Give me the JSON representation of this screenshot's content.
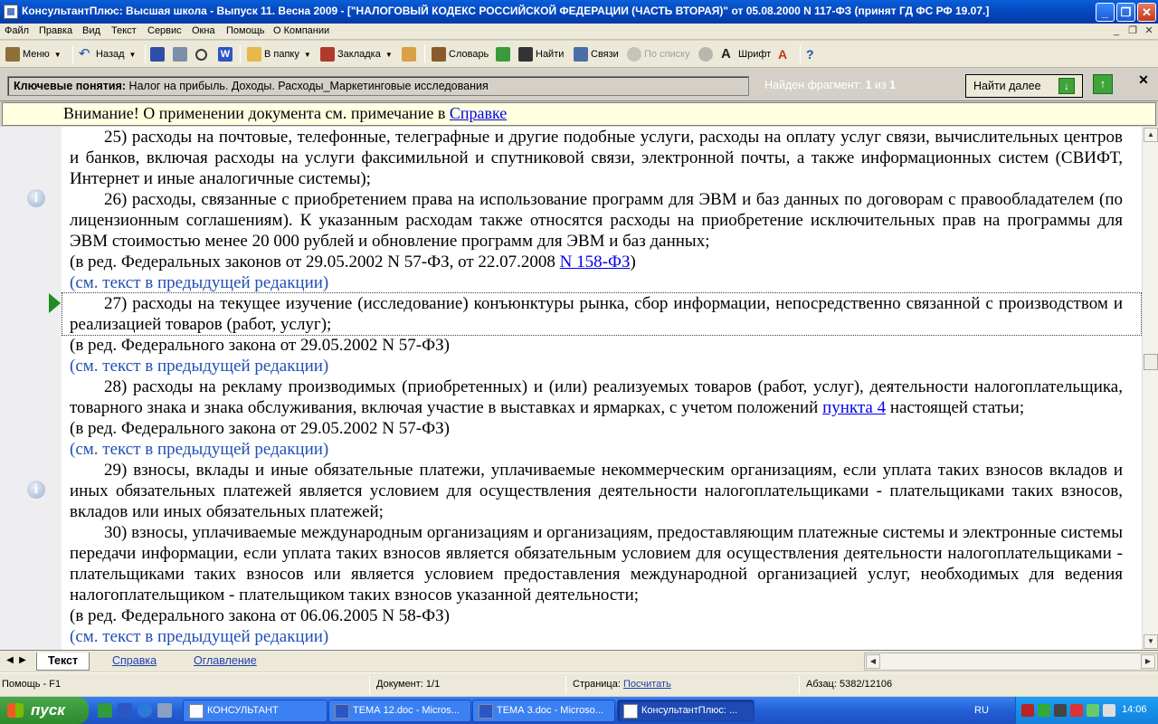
{
  "window": {
    "title": "КонсультантПлюс: Высшая школа - Выпуск 11. Весна 2009 - [\"НАЛОГОВЫЙ КОДЕКС РОССИЙСКОЙ ФЕДЕРАЦИИ (ЧАСТЬ ВТОРАЯ)\" от 05.08.2000 N 117-ФЗ (принят ГД ФС РФ 19.07.]"
  },
  "menu": [
    "Файл",
    "Правка",
    "Вид",
    "Текст",
    "Сервис",
    "Окна",
    "Помощь",
    "О Компании"
  ],
  "toolbar": {
    "menu": "Меню",
    "back": "Назад",
    "folder": "В папку",
    "bookmark": "Закладка",
    "dictionary": "Словарь",
    "find": "Найти",
    "links": "Связи",
    "by_list": "По списку",
    "font": "Шрифт"
  },
  "search": {
    "key_label": "Ключевые понятия:",
    "key_value": "Налог на прибыль. Доходы. Расходы_Маркетинговые исследования",
    "found_prefix": "Найден фрагмент:",
    "found_current": "1",
    "found_sep": "из",
    "found_total": "1",
    "find_next": "Найти далее"
  },
  "notice": {
    "text": "Внимание! О применении документа см. примечание в ",
    "link": "Справке"
  },
  "document": {
    "p25": "25) расходы на почтовые, телефонные, телеграфные и другие подобные услуги, расходы на оплату услуг связи, вычислительных центров и банков, включая расходы на услуги факсимильной и спутниковой связи, электронной почты, а также информационных систем (СВИФТ, Интернет и иные аналогичные системы);",
    "p26": "26) расходы, связанные с приобретением права на использование программ для ЭВМ и баз данных по договорам с правообладателем (по лицензионным соглашениям). К указанным расходам также относятся расходы на приобретение исключительных прав на программы для ЭВМ стоимостью менее 20 000 рублей и обновление программ для ЭВМ и баз данных;",
    "ed26_text": "(в ред. Федеральных законов от 29.05.2002 N 57-ФЗ, от 22.07.2008 ",
    "ed26_link": "N 158-ФЗ",
    "ed26_end": ")",
    "prev26": "(см. текст в предыдущей редакции)",
    "p27": "27) расходы на текущее изучение (исследование) конъюнктуры рынка, сбор информации, непосредственно связанной с производством и реализацией товаров (работ, услуг);",
    "ed27": "(в ред. Федерального закона от 29.05.2002 N 57-ФЗ)",
    "prev27": "(см. текст в предыдущей редакции)",
    "p28_text": "28) расходы на рекламу производимых (приобретенных) и (или) реализуемых товаров (работ, услуг), деятельности налогоплательщика, товарного знака и знака обслуживания, включая участие в выставках и ярмарках, с учетом положений ",
    "p28_link": "пункта 4",
    "p28_end": " настоящей статьи;",
    "ed28": "(в ред. Федерального закона от 29.05.2002 N 57-ФЗ)",
    "prev28": "(см. текст в предыдущей редакции)",
    "p29": "29) взносы, вклады и иные обязательные платежи, уплачиваемые некоммерческим организациям, если уплата таких взносов вкладов и иных обязательных платежей является условием для осуществления деятельности налогоплательщиками - плательщиками таких взносов, вкладов или иных обязательных платежей;",
    "p30": "30) взносы, уплачиваемые международным организациям и организациям, предоставляющим платежные системы и электронные системы передачи информации, если уплата таких взносов является обязательным условием для осуществления деятельности налогоплательщиками - плательщиками таких взносов или является условием предоставления международной организацией услуг, необходимых для ведения налогоплательщиком - плательщиком таких взносов указанной деятельности;",
    "ed30": "(в ред. Федерального закона от 06.06.2005 N 58-ФЗ)",
    "prev30": "(см. текст в предыдущей редакции)"
  },
  "tabs": [
    "Текст",
    "Справка",
    "Оглавление"
  ],
  "status": {
    "help": "Помощь - F1",
    "doc": "Документ: 1/1",
    "page_label": "Страница:",
    "page_link": "Посчитать",
    "paragraph": "Абзац: 5382/12106"
  },
  "taskbar": {
    "start": "пуск",
    "items": [
      "КОНСУЛЬТАНТ",
      "ТЕМА 12.doc - Micros...",
      "ТЕМА 3.doc - Microso...",
      "КонсультантПлюс: ..."
    ],
    "lang": "RU",
    "clock": "14:06"
  },
  "colors": {
    "accent": "#0449c1",
    "link": "#0000ee",
    "prev_edition": "#1f4fb5",
    "marker": "#1e8c1e",
    "notice_bg": "#ffffe1"
  }
}
